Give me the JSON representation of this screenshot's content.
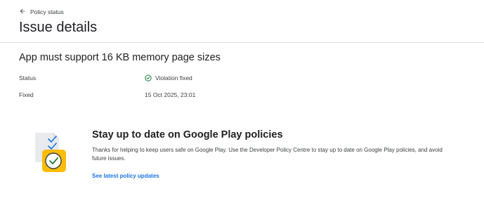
{
  "header": {
    "back_label": "Policy status",
    "title": "Issue details"
  },
  "issue": {
    "title": "App must support 16 KB memory page sizes",
    "rows": [
      {
        "label": "Status",
        "value": "Violation fixed"
      },
      {
        "label": "Fixed",
        "value": "15 Oct 2025, 23:01"
      }
    ]
  },
  "promo": {
    "title": "Stay up to date on Google Play policies",
    "body": "Thanks for helping to keep users safe on Google Play. Use the Developer Policy Centre to stay up to date on Google Play policies, and avoid future issues.",
    "link": "See latest policy updates"
  },
  "colors": {
    "accent": "#1a73e8",
    "success": "#188038",
    "divider": "#dadce0",
    "illustration_yellow": "#fbbc04"
  },
  "icons": {
    "back": "arrow-left-icon",
    "status": "check-circle-icon",
    "illustration": "policy-checklist-illustration"
  }
}
